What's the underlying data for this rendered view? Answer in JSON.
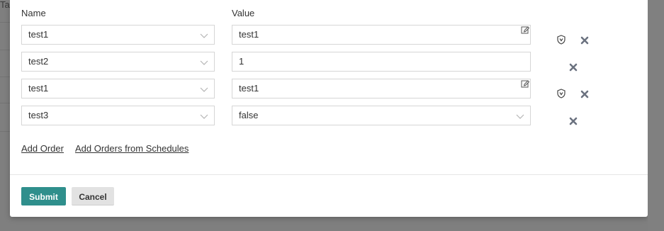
{
  "background": {
    "tab_fragment": "Tas"
  },
  "form": {
    "name_header": "Name",
    "value_header": "Value",
    "rows": [
      {
        "name": "test1",
        "value": "test1",
        "value_type": "text-editable",
        "has_shield": true
      },
      {
        "name": "test2",
        "value": "1",
        "value_type": "text",
        "has_shield": false
      },
      {
        "name": "test1",
        "value": "test1",
        "value_type": "text-editable",
        "has_shield": true
      },
      {
        "name": "test3",
        "value": "false",
        "value_type": "select",
        "has_shield": false
      }
    ],
    "add_order_label": "Add Order",
    "add_from_schedules_label": "Add Orders from Schedules"
  },
  "footer": {
    "submit_label": "Submit",
    "cancel_label": "Cancel"
  },
  "colors": {
    "accent": "#2f8f8c",
    "icon": "#6b7280"
  }
}
